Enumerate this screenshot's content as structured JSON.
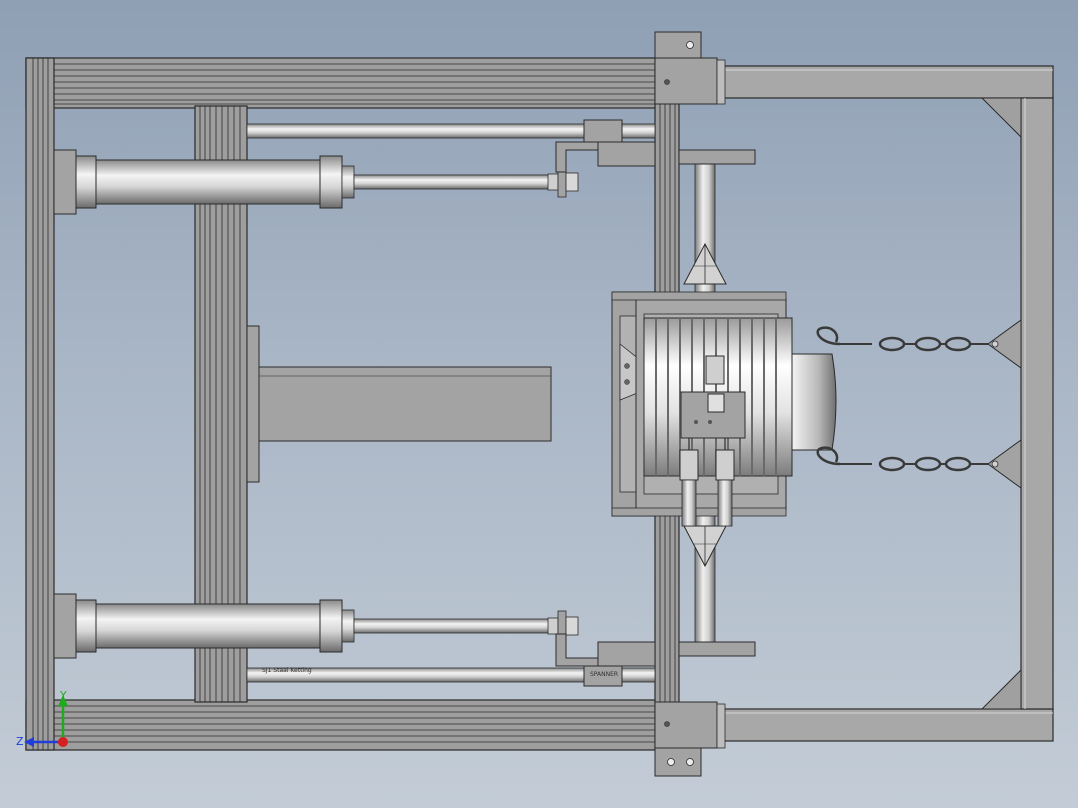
{
  "triad": {
    "y_label": "Y",
    "z_label": "Z",
    "y_color": "#1faa1f",
    "z_color": "#1f3fd8",
    "x_color": "#d81f1f"
  },
  "rod_labels": {
    "upper_rod": "",
    "lower_rod_left": "SJ1 Staal Ketting",
    "lower_rod_right": "SPANNER"
  },
  "colors": {
    "frame_fill": "#9c9c9c",
    "frame_stroke": "#2b2b2b",
    "cylinder_light": "#f2f2f2",
    "cylinder_dark": "#6e6e6e",
    "plate_fill": "#a3a3a3",
    "background_top": "#8f9fb4",
    "background_bottom": "#c3ccd6"
  }
}
